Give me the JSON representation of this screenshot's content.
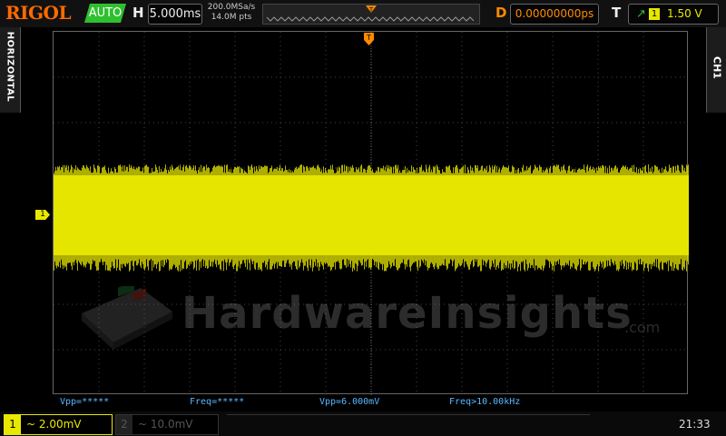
{
  "header": {
    "brand": "RIGOL",
    "run_mode": "AUTO",
    "timebase_label": "H",
    "timebase_value": "5.000ms",
    "sample_rate": "200.0MSa/s",
    "memory_depth": "14.0M pts",
    "memory_marker": "T",
    "delay_label": "D",
    "delay_value": "0.00000000ps",
    "trigger_label": "T",
    "trigger_slope_icon": "rising-edge-icon",
    "trigger_source": "1",
    "trigger_level": "1.50 V"
  },
  "side_tabs": {
    "left": "HORIZONTAL",
    "right": "CH1"
  },
  "markers": {
    "trigger_position": "T",
    "channel1": "1"
  },
  "watermark": {
    "text": "HardwareInsights",
    "suffix": ".com"
  },
  "measurements": [
    "Vpp=*****",
    "Freq=*****",
    "Vpp=6.000mV",
    "Freq>10.00kHz"
  ],
  "channels": {
    "ch1": {
      "number": "1",
      "scale": "~ 2.00mV",
      "color": "#e8e800",
      "active": true
    },
    "ch2": {
      "number": "2",
      "scale": "~ 10.0mV",
      "color": "#555555",
      "active": false
    }
  },
  "status": {
    "clock": "21:33"
  },
  "colors": {
    "trace": "#e8e800",
    "accent": "#ff6a00",
    "measure": "#5ab8ff",
    "auto": "#2ec02e"
  }
}
